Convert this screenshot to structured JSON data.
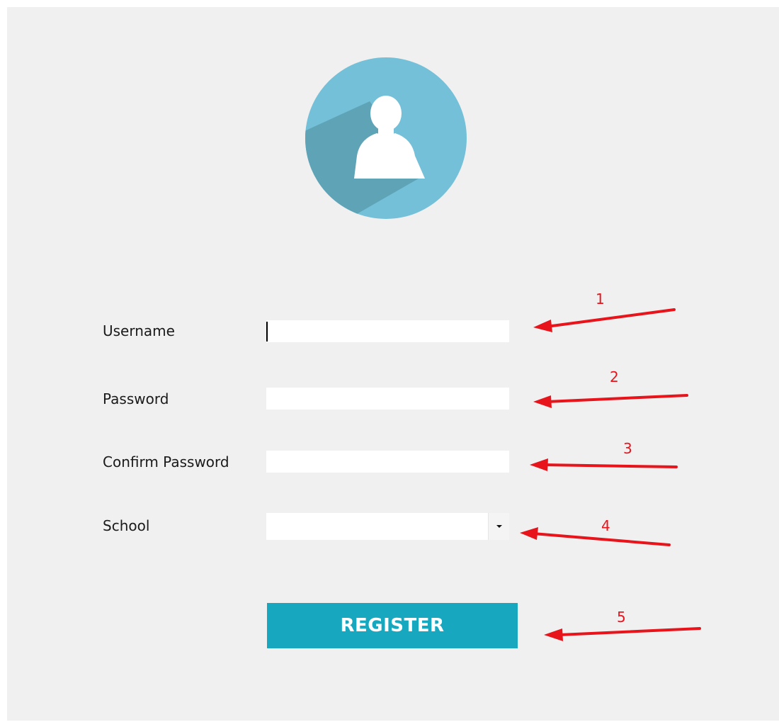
{
  "form": {
    "username_label": "Username",
    "password_label": "Password",
    "confirm_password_label": "Confirm Password",
    "school_label": "School",
    "username_value": "",
    "password_value": "",
    "confirm_password_value": "",
    "school_selected": ""
  },
  "actions": {
    "register_label": "REGISTER"
  },
  "annotations": {
    "markers": [
      "1",
      "2",
      "3",
      "4",
      "5"
    ],
    "color": "#e8141c"
  },
  "icons": {
    "avatar": "user-avatar-icon",
    "dropdown": "chevron-down-icon"
  },
  "colors": {
    "background": "#f0f0f0",
    "avatar_circle": "#74c0d8",
    "avatar_shadow": "#5fa3b6",
    "button": "#17a8c0",
    "field": "#ffffff"
  }
}
